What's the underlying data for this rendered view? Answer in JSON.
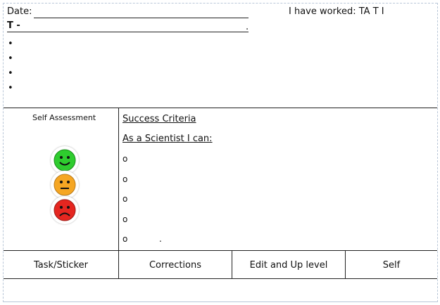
{
  "header": {
    "date_label": "Date:",
    "worked_label": "I have worked: TA  T  I",
    "title_prefix": "T -",
    "title_end": ".",
    "bullets": [
      "•",
      "•",
      "•",
      "•"
    ]
  },
  "self_assessment": {
    "title": "Self Assessment",
    "faces": [
      {
        "name": "happy",
        "color": "#2ecc2e"
      },
      {
        "name": "neutral",
        "color": "#f5a623"
      },
      {
        "name": "sad",
        "color": "#e52620"
      }
    ]
  },
  "success": {
    "heading": "Success Criteria",
    "subheading": "As a Scientist I can:",
    "items": [
      "o",
      "o",
      "o",
      "o",
      "o"
    ],
    "last_dot": "."
  },
  "footer": {
    "cells": [
      "Task/Sticker",
      "Corrections",
      "Edit and Up level",
      "Self"
    ]
  }
}
